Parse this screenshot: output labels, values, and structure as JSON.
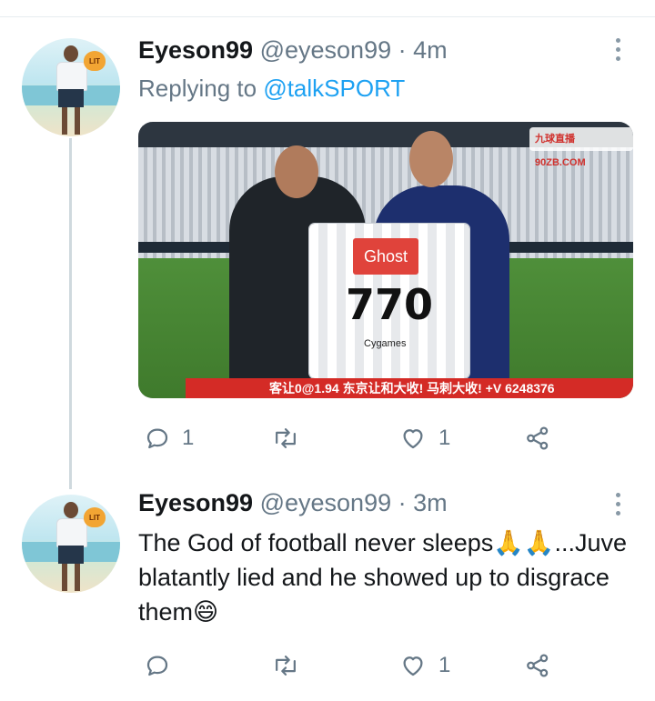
{
  "tweets": [
    {
      "name": "Eyeson99",
      "handle": "@eyeson99",
      "time": "· 4m",
      "reply_prefix": "Replying to",
      "reply_to": "@talkSPORT",
      "media": {
        "logo_text": "九球直播 90ZB.COM",
        "sponsor": "Ghost",
        "number": "770",
        "brand": "Cygames",
        "ticker": "客让0@1.94 东京让和大收! 马刺大收! +V 6248376"
      },
      "actions": {
        "reply_count": "1",
        "retweet_count": "",
        "like_count": "1"
      }
    },
    {
      "name": "Eyeson99",
      "handle": "@eyeson99",
      "time": "· 3m",
      "text": "The God of football never sleeps🙏🙏...Juve blatantly lied and he showed up to disgrace them😄",
      "actions": {
        "reply_count": "",
        "retweet_count": "",
        "like_count": "1"
      }
    }
  ],
  "colors": {
    "accent": "#1da1f2",
    "muted": "#657786",
    "text": "#14171a"
  },
  "icons": [
    "reply-icon",
    "retweet-icon",
    "like-icon",
    "share-icon",
    "more-options-icon"
  ]
}
